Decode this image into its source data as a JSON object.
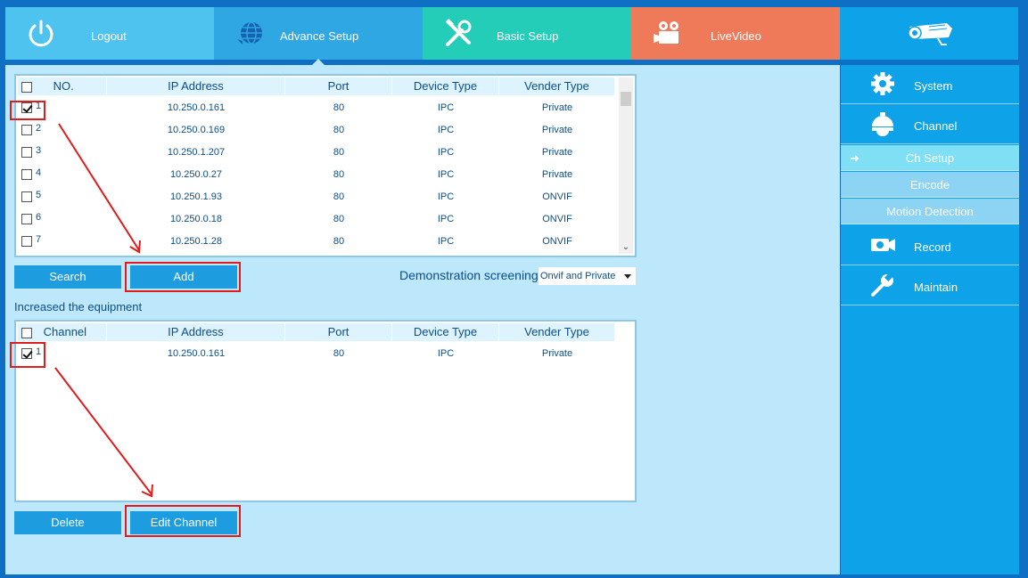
{
  "topnav": {
    "tabs": [
      {
        "label": "Logout",
        "icon": "power-icon"
      },
      {
        "label": "Advance Setup",
        "icon": "globe-icon"
      },
      {
        "label": "Basic Setup",
        "icon": "tools-icon"
      },
      {
        "label": "LiveVideo",
        "icon": "video-camera-icon"
      },
      {
        "label": "",
        "icon": "bullet-camera-icon"
      }
    ],
    "colors": {
      "logout": "#4ec3ef",
      "advance": "#2fa7e2",
      "basic": "#23cdb8",
      "live": "#ef7a5a",
      "camera": "#0ea2e8"
    }
  },
  "search_grid": {
    "headers": [
      "NO.",
      "IP Address",
      "Port",
      "Device Type",
      "Vender Type"
    ],
    "rows": [
      {
        "no": "1",
        "ip": "10.250.0.161",
        "port": "80",
        "device": "IPC",
        "vender": "Private",
        "checked": true
      },
      {
        "no": "2",
        "ip": "10.250.0.169",
        "port": "80",
        "device": "IPC",
        "vender": "Private",
        "checked": false
      },
      {
        "no": "3",
        "ip": "10.250.1.207",
        "port": "80",
        "device": "IPC",
        "vender": "Private",
        "checked": false
      },
      {
        "no": "4",
        "ip": "10.250.0.27",
        "port": "80",
        "device": "IPC",
        "vender": "Private",
        "checked": false
      },
      {
        "no": "5",
        "ip": "10.250.1.93",
        "port": "80",
        "device": "IPC",
        "vender": "ONVIF",
        "checked": false
      },
      {
        "no": "6",
        "ip": "10.250.0.18",
        "port": "80",
        "device": "IPC",
        "vender": "ONVIF",
        "checked": false
      },
      {
        "no": "7",
        "ip": "10.250.1.28",
        "port": "80",
        "device": "IPC",
        "vender": "ONVIF",
        "checked": false
      }
    ]
  },
  "buttons": {
    "search": "Search",
    "add": "Add",
    "delete": "Delete",
    "edit_channel": "Edit Channel"
  },
  "filter": {
    "label": "Demonstration screening",
    "selected": "Onvif and Private"
  },
  "added": {
    "title": "Increased the equipment",
    "headers": [
      "Channel",
      "IP Address",
      "Port",
      "Device Type",
      "Vender Type"
    ],
    "rows": [
      {
        "channel": "1",
        "ip": "10.250.0.161",
        "port": "80",
        "device": "IPC",
        "vender": "Private",
        "checked": true
      }
    ]
  },
  "sidebar": {
    "items": [
      {
        "label": "System",
        "icon": "gear-icon"
      },
      {
        "label": "Channel",
        "icon": "dome-camera-icon"
      },
      {
        "label": "Record",
        "icon": "record-camera-icon"
      },
      {
        "label": "Maintain",
        "icon": "wrench-icon"
      }
    ],
    "sub_items": [
      "Ch Setup",
      "Encode",
      "Motion Detection"
    ],
    "active_sub": "Ch Setup"
  }
}
